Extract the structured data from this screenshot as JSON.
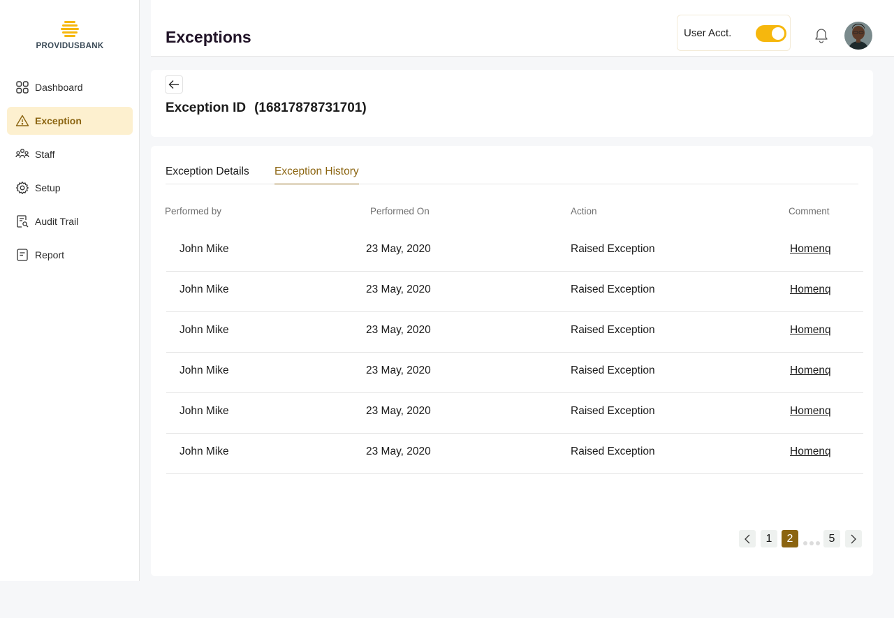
{
  "brand": {
    "name": "PROVIDUSBANK",
    "accent": "#f6b70d",
    "active_color": "#8b6410"
  },
  "sidebar": {
    "items": [
      {
        "label": "Dashboard",
        "icon": "grid-icon"
      },
      {
        "label": "Exception",
        "icon": "warning-icon",
        "active": true
      },
      {
        "label": "Staff",
        "icon": "people-icon"
      },
      {
        "label": "Setup",
        "icon": "gear-icon"
      },
      {
        "label": "Audit Trail",
        "icon": "audit-search-icon"
      },
      {
        "label": "Report",
        "icon": "report-icon"
      }
    ]
  },
  "header": {
    "title": "Exceptions",
    "toggle_label": "User Acct.",
    "toggle_on": true
  },
  "exception": {
    "id_label": "Exception ID",
    "id_value": "(16817878731701)"
  },
  "tabs": [
    {
      "label": "Exception Details",
      "active": false
    },
    {
      "label": "Exception History",
      "active": true
    }
  ],
  "table": {
    "headers": [
      "Performed by",
      "Performed On",
      "Action",
      "Comment"
    ],
    "rows": [
      [
        "John Mike",
        "23 May, 2020",
        "Raised Exception",
        "Homenq"
      ],
      [
        "John Mike",
        "23 May, 2020",
        "Raised Exception",
        "Homenq"
      ],
      [
        "John Mike",
        "23 May, 2020",
        "Raised Exception",
        "Homenq"
      ],
      [
        "John Mike",
        "23 May, 2020",
        "Raised Exception",
        "Homenq"
      ],
      [
        "John Mike",
        "23 May, 2020",
        "Raised Exception",
        "Homenq"
      ],
      [
        "John Mike",
        "23 May, 2020",
        "Raised Exception",
        "Homenq"
      ]
    ]
  },
  "pagination": {
    "pages": [
      "1",
      "2",
      "5"
    ],
    "current": "2"
  }
}
